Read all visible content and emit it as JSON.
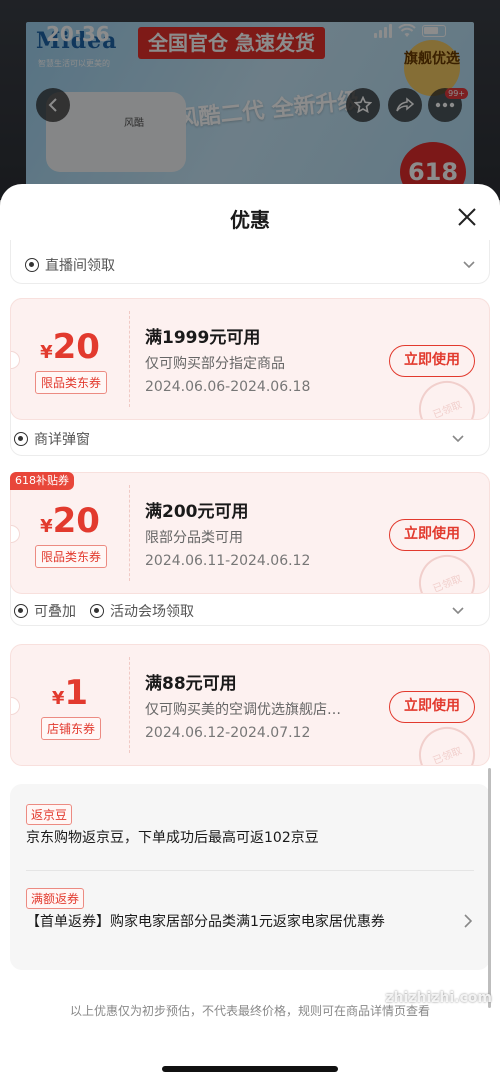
{
  "status_bar": {
    "time": "20:36"
  },
  "background": {
    "brand": "Midea",
    "brand_sub": "智慧生活可以更美的",
    "ad_text": "全国官仓 急速发货",
    "slogan": "风酷二代 全新升级",
    "flag_text": "旗舰优选",
    "promo": "618",
    "badge": "99+",
    "ac_label": "风酷"
  },
  "sheet": {
    "title": "优惠",
    "top_source": {
      "label": "直播间领取"
    },
    "coupons": [
      {
        "symbol": "¥",
        "amount": "20",
        "type": "限品类东券",
        "condition": "满1999元可用",
        "desc": "仅可购买部分指定商品",
        "date": "2024.06.06-2024.06.18",
        "button": "立即使用",
        "stamp": "已领取",
        "sources": [
          "商详弹窗"
        ]
      },
      {
        "tag": "618补贴券",
        "symbol": "¥",
        "amount": "20",
        "type": "限品类东券",
        "condition": "满200元可用",
        "desc": "限部分品类可用",
        "date": "2024.06.11-2024.06.12",
        "button": "立即使用",
        "stamp": "已领取",
        "sources": [
          "可叠加",
          "活动会场领取"
        ]
      },
      {
        "symbol": "¥",
        "amount": "1",
        "type": "店铺东券",
        "condition": "满88元可用",
        "desc": "仅可购买美的空调优选旗舰店…",
        "date": "2024.06.12-2024.07.12",
        "button": "立即使用",
        "stamp": "已领取"
      }
    ],
    "info": [
      {
        "tag": "返京豆",
        "text": "京东购物返京豆，下单成功后最高可返102京豆"
      },
      {
        "tag": "满额返券",
        "text": "【首单返券】购家电家居部分品类满1元返家电家居优惠券"
      }
    ],
    "footnote": "以上优惠仅为初步预估，不代表最终价格，规则可在商品详情页查看"
  },
  "watermark": "zhizhizhi.com",
  "colors": {
    "accent": "#e23a2e",
    "coupon_bg": "#fdf1f0"
  }
}
